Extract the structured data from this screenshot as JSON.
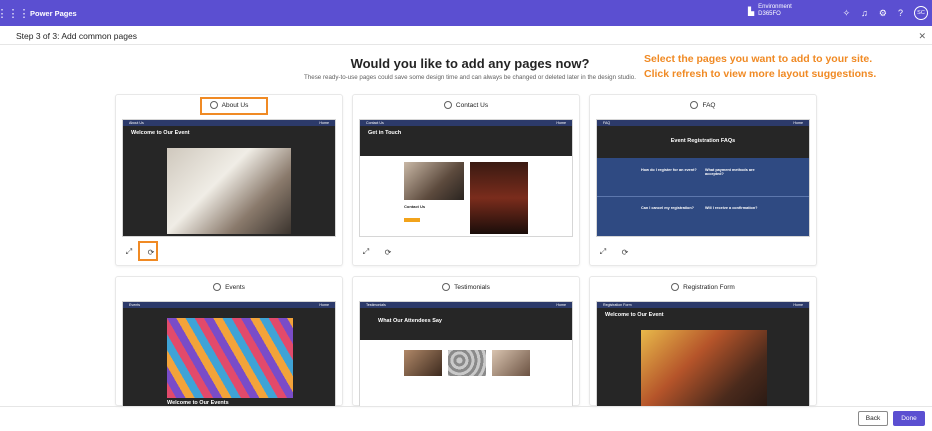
{
  "app": {
    "title": "Power Pages"
  },
  "environment": {
    "label": "Environment",
    "name": "D365FO"
  },
  "topbar_icons": [
    "bell-icon",
    "settings-icon",
    "help-icon"
  ],
  "user": {
    "initials": "SC"
  },
  "step": {
    "title": "Step 3 of 3: Add common pages"
  },
  "headline": "Would you like to add any pages now?",
  "subline": "These ready-to-use pages could save some design time and can always be changed or deleted later in the design studio.",
  "annotation": {
    "line1": "Select the pages you want to add to your site.",
    "line2": "Click refresh to view more layout suggestions."
  },
  "cards": [
    {
      "label": "About Us",
      "nav": "About Us",
      "title": "Welcome to Our Event"
    },
    {
      "label": "Contact Us",
      "nav": "Contact Us",
      "title": "Get in Touch",
      "sub": "Contact Us"
    },
    {
      "label": "FAQ",
      "nav": "FAQ",
      "title": "Event Registration FAQs",
      "q1": "How do I register for an event?",
      "q2": "What payment methods are accepted?",
      "q3": "Can I cancel my registration?",
      "q4": "Will I receive a confirmation?"
    },
    {
      "label": "Events",
      "nav": "Events",
      "title": "Welcome to Our Events"
    },
    {
      "label": "Testimonials",
      "nav": "Testimonials",
      "title": "What Our Attendees Say"
    },
    {
      "label": "Registration Form",
      "nav": "Registration Form",
      "title": "Welcome to Our Event"
    }
  ],
  "nav_home": "Home",
  "buttons": {
    "back": "Back",
    "done": "Done"
  },
  "colors": {
    "brand": "#5b4fd1",
    "annotation": "#f08a24",
    "preview_nav": "#2c3a6a"
  }
}
